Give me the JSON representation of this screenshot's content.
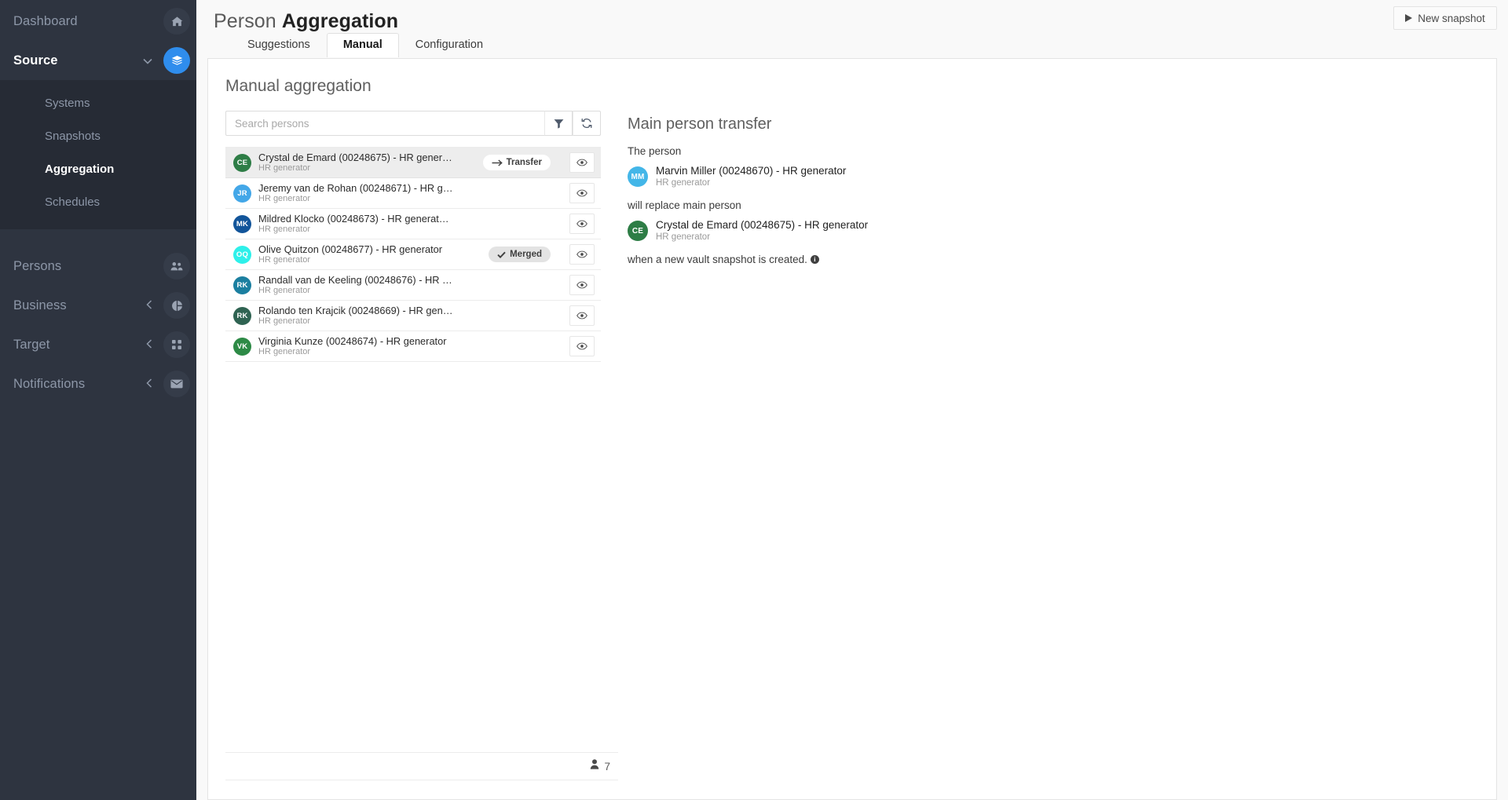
{
  "sidebar": {
    "items": [
      {
        "label": "Dashboard",
        "icon": "home-icon",
        "active": false,
        "caret": "",
        "bubble": "dark"
      },
      {
        "label": "Source",
        "icon": "layers-icon",
        "active": true,
        "caret": "down",
        "bubble": "accent"
      },
      {
        "label": "Persons",
        "icon": "people-icon",
        "active": false,
        "caret": "",
        "bubble": "dark"
      },
      {
        "label": "Business",
        "icon": "pie-icon",
        "active": false,
        "caret": "left",
        "bubble": "dark"
      },
      {
        "label": "Target",
        "icon": "grid-icon",
        "active": false,
        "caret": "left",
        "bubble": "dark"
      },
      {
        "label": "Notifications",
        "icon": "envelope-icon",
        "active": false,
        "caret": "left",
        "bubble": "dark"
      }
    ],
    "submenu": [
      {
        "label": "Systems",
        "active": false
      },
      {
        "label": "Snapshots",
        "active": false
      },
      {
        "label": "Aggregation",
        "active": true
      },
      {
        "label": "Schedules",
        "active": false
      }
    ]
  },
  "header": {
    "title_light": "Person",
    "title_bold": "Aggregation",
    "new_snapshot_label": "New snapshot"
  },
  "tabs": [
    {
      "label": "Suggestions",
      "active": false
    },
    {
      "label": "Manual",
      "active": true
    },
    {
      "label": "Configuration",
      "active": false
    }
  ],
  "manual": {
    "section_title": "Manual aggregation",
    "search_placeholder": "Search persons",
    "search_value": "",
    "filter_icon": "filter-icon",
    "refresh_icon": "refresh-icon",
    "persons": [
      {
        "initials": "CE",
        "color": "#2e7d46",
        "name": "Crystal de Emard (00248675) - HR gener…",
        "sub": "HR generator",
        "badge": "Transfer",
        "badge_type": "transfer",
        "badge_icon": "arrow-right-icon",
        "selected": true
      },
      {
        "initials": "JR",
        "color": "#43a7e8",
        "name": "Jeremy van de Rohan (00248671) - HR g…",
        "sub": "HR generator",
        "badge": "",
        "badge_type": "",
        "badge_icon": "",
        "selected": false
      },
      {
        "initials": "MK",
        "color": "#12559a",
        "name": "Mildred Klocko (00248673) - HR generat…",
        "sub": "HR generator",
        "badge": "",
        "badge_type": "",
        "badge_icon": "",
        "selected": false
      },
      {
        "initials": "OQ",
        "color": "#2ef0ea",
        "name": "Olive Quitzon (00248677) - HR generator",
        "sub": "HR generator",
        "badge": "Merged",
        "badge_type": "merged",
        "badge_icon": "check-icon",
        "selected": false
      },
      {
        "initials": "RK",
        "color": "#1b7fa0",
        "name": "Randall van de Keeling (00248676) - HR …",
        "sub": "HR generator",
        "badge": "",
        "badge_type": "",
        "badge_icon": "",
        "selected": false
      },
      {
        "initials": "RK",
        "color": "#2f6352",
        "name": "Rolando ten Krajcik (00248669) - HR gen…",
        "sub": "HR generator",
        "badge": "",
        "badge_type": "",
        "badge_icon": "",
        "selected": false
      },
      {
        "initials": "VK",
        "color": "#2d8a46",
        "name": "Virginia Kunze (00248674) - HR generator",
        "sub": "HR generator",
        "badge": "",
        "badge_type": "",
        "badge_icon": "",
        "selected": false
      }
    ],
    "footer_count": "7",
    "footer_icon": "person-icon"
  },
  "detail": {
    "title": "Main person transfer",
    "line1": "The person",
    "source_person": {
      "initials": "MM",
      "color": "#43b6e8",
      "name": "Marvin Miller (00248670) - HR generator",
      "sub": "HR generator"
    },
    "line2": "will replace main person",
    "target_person": {
      "initials": "CE",
      "color": "#2e7d46",
      "name": "Crystal de Emard (00248675) - HR generator",
      "sub": "HR generator"
    },
    "line3": "when a new vault snapshot is created.",
    "info_icon": "info-icon"
  }
}
